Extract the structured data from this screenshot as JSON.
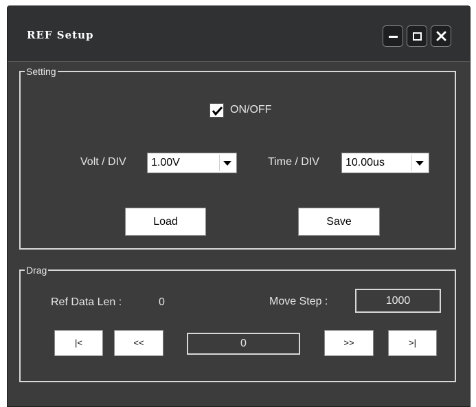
{
  "window": {
    "title": "REF Setup",
    "controls": [
      "minimize-icon",
      "maximize-icon",
      "close-icon"
    ]
  },
  "setting": {
    "group_label": "Setting",
    "on_off": {
      "label": "ON/OFF",
      "checked": true
    },
    "volt_div": {
      "label": "Volt / DIV",
      "value": "1.00V"
    },
    "time_div": {
      "label": "Time / DIV",
      "value": "10.00us"
    },
    "load_label": "Load",
    "save_label": "Save"
  },
  "drag": {
    "group_label": "Drag",
    "ref_data_len_label": "Ref Data Len :",
    "ref_data_len_value": "0",
    "move_step_label": "Move Step :",
    "move_step_value": "1000",
    "position_value": "0",
    "nav": {
      "first": "|<",
      "prev": "<<",
      "next": ">>",
      "last": ">|"
    }
  },
  "colors": {
    "window_bg": "#3c3c3c",
    "titlebar_bg": "#2f3133",
    "text": "#e6e6e6"
  }
}
